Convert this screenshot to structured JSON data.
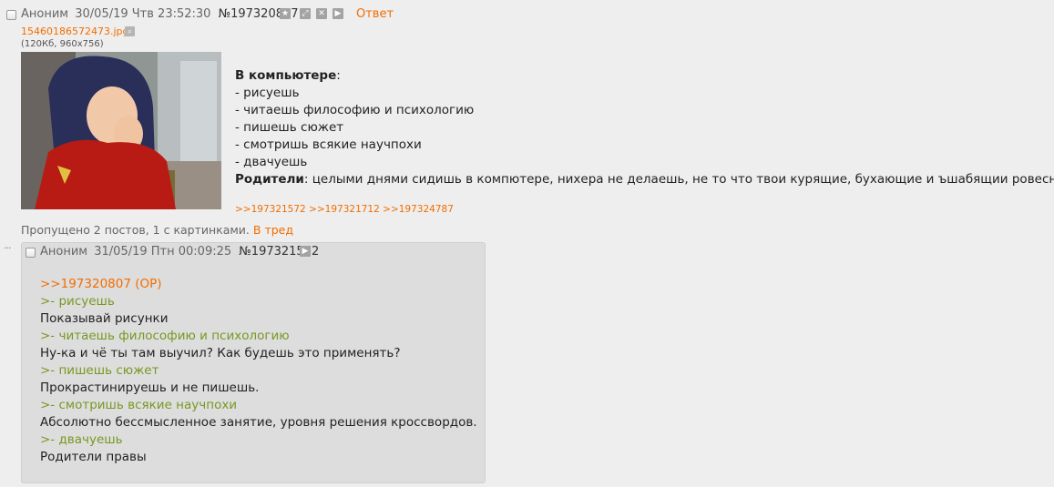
{
  "op": {
    "author": "Аноним",
    "date": "30/05/19 Чтв 23:52:30",
    "number": "№197320807",
    "reply_label": "Ответ",
    "file_name": "15460186572473.jpg",
    "file_info": "(120Кб, 960x756)",
    "message": {
      "heading": "В компьютере",
      "heading_suffix": ":",
      "items": [
        "- рисуешь",
        "- читаешь философию и психологию",
        "- пишешь сюжет",
        "- смотришь всякие научпохи",
        "- двачуешь"
      ],
      "parents_label": "Родители",
      "parents_text": ": целыми днями сидишь в компютере, нихера не делаешь, не то что твои курящие, бухающие и ъшабящии ровесники!"
    },
    "replies": [
      ">>197321572",
      ">>197321712",
      ">>197324787"
    ]
  },
  "omitted": {
    "text": "Пропущено 2 постов, 1 с картинками.",
    "link": "В тред"
  },
  "reply": {
    "dots": "···",
    "author": "Аноним",
    "date": "31/05/19 Птн 00:09:25",
    "number": "№197321572",
    "op_link": ">>197320807 (OP)",
    "lines": [
      {
        "type": "quote",
        "text": ">- рисуешь"
      },
      {
        "type": "text",
        "text": "Показывай рисунки"
      },
      {
        "type": "quote",
        "text": ">- читаешь философию и психологию"
      },
      {
        "type": "text",
        "text": "Ну-ка и чё ты там выучил? Как будешь это применять?"
      },
      {
        "type": "quote",
        "text": ">- пишешь сюжет"
      },
      {
        "type": "text",
        "text": "Прокрастинируешь и не пишешь."
      },
      {
        "type": "quote",
        "text": ">- смотришь всякие научпохи"
      },
      {
        "type": "text",
        "text": "Абсолютно бессмысленное занятие, уровня решения кроссвордов."
      },
      {
        "type": "quote",
        "text": ">- двачуешь"
      },
      {
        "type": "text",
        "text": "Родители правы"
      }
    ]
  },
  "icons": {
    "favorite": "star-icon",
    "expand": "expand-icon",
    "hide": "hide-icon",
    "play": "play-icon",
    "search": "magnifier-icon"
  },
  "colors": {
    "background": "#eeeeee",
    "accent": "#f26d00",
    "quote": "#789922",
    "reply_bg": "#dddddd"
  }
}
